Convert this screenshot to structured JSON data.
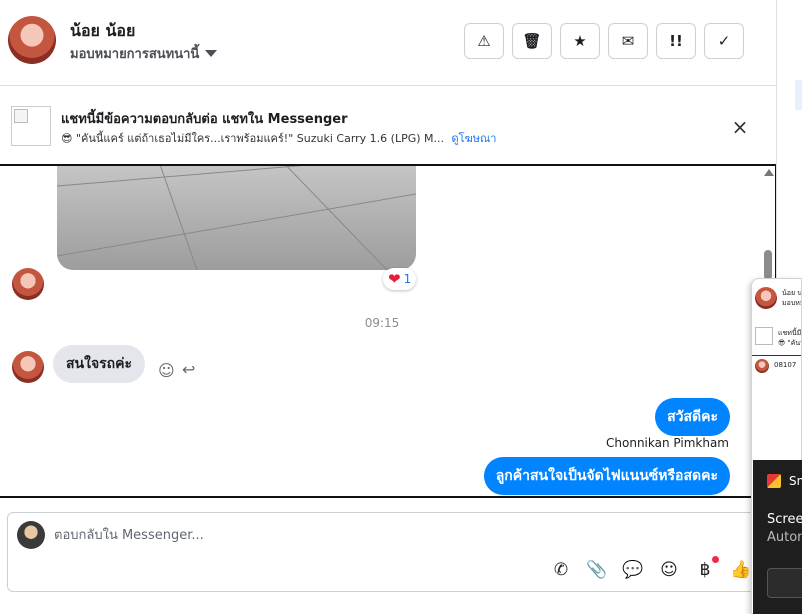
{
  "header": {
    "name": "น้อย น้อย",
    "assign_label": "มอบหมายการสนทนานี้",
    "actions": [
      {
        "icon": "warning-icon",
        "glyph": "⚠"
      },
      {
        "icon": "trash-icon",
        "glyph": "🗑"
      },
      {
        "icon": "star-icon",
        "glyph": "★"
      },
      {
        "icon": "mark-unread-icon",
        "glyph": "✉"
      },
      {
        "icon": "priority-icon",
        "glyph": "!!"
      },
      {
        "icon": "check-icon",
        "glyph": "✓"
      }
    ]
  },
  "banner": {
    "title": "แชทนี้มีข้อความตอบกลับต่อ แชทใน Messenger",
    "subtitle": "😎 \"คันนี้แคร์ แต่ถ้าเธอไม่มีใคร...เราพร้อมแคร์!\" Suzuki Carry 1.6 (LPG) M...",
    "link": "ดูโฆษณา",
    "close": "×"
  },
  "chat": {
    "reaction_emoji": "❤",
    "reaction_count": "1",
    "timestamp": "09:15",
    "incoming_message": "สนใจรถค่ะ",
    "emoji_icon": "☺",
    "reply_icon": "↩",
    "outgoing_1": "สวัสดีคะ",
    "sender_name": "Chonnikan Pimkham",
    "outgoing_2": "ลูกค้าสนใจเป็นจัดไฟแนนซ์หรือสดคะ"
  },
  "composer": {
    "placeholder": "ตอบกลับใน Messenger...",
    "icons": [
      {
        "name": "phone-icon",
        "glyph": "✆"
      },
      {
        "name": "attachment-icon",
        "glyph": "📎"
      },
      {
        "name": "saved-replies-icon",
        "glyph": "💬"
      },
      {
        "name": "emoji-picker-icon",
        "glyph": "☺"
      },
      {
        "name": "payment-icon",
        "glyph": "฿"
      },
      {
        "name": "thumbs-up-icon",
        "glyph": "👍"
      }
    ]
  },
  "popup": {
    "name": "น้อย น",
    "assign": "มอบหม",
    "banner": "แชทนี้มี",
    "banner_sub": "😎 \"คันนี้",
    "number": "08107"
  },
  "notification": {
    "app": "Sn",
    "title": "Screen",
    "subtitle": "Autom"
  },
  "colors": {
    "accent": "#0084ff",
    "link": "#1877f2",
    "bubble_in": "#e4e6eb"
  }
}
